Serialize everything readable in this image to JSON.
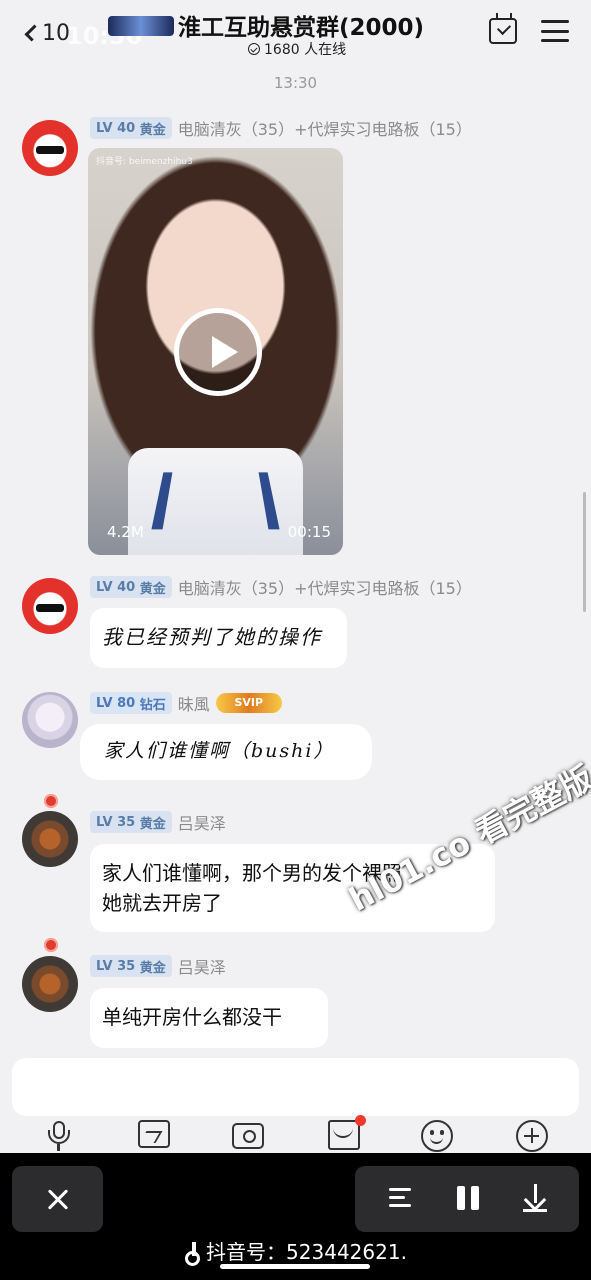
{
  "header": {
    "back_count": "10",
    "status_time": "10:50",
    "title": "淮工互助悬赏群(2000)",
    "online": "1680 人在线"
  },
  "timestamp": "13:30",
  "messages": [
    {
      "level": "LV 40",
      "rank": "黄金",
      "nick": "电脑清灰（35）+代焊实习电路板（15）",
      "type": "video",
      "video": {
        "size": "4.2M",
        "duration": "00:15",
        "watermark": "抖音号: beimenzhihu3"
      }
    },
    {
      "level": "LV 40",
      "rank": "黄金",
      "nick": "电脑清灰（35）+代焊实习电路板（15）",
      "type": "text",
      "text": "我已经预判了她的操作"
    },
    {
      "level": "LV 80",
      "rank": "钻石",
      "nick": "昧風",
      "badge": "SVIP",
      "type": "text",
      "text": "家人们谁懂啊（bushi）"
    },
    {
      "level": "LV 35",
      "rank": "黄金",
      "nick": "吕昊泽",
      "type": "text",
      "text_lines": [
        "家人们谁懂啊，那个男的发个裸照",
        "她就去开房了"
      ]
    },
    {
      "level": "LV 35",
      "rank": "黄金",
      "nick": "吕昊泽",
      "type": "text",
      "text": "单纯开房什么都没干"
    }
  ],
  "overlay_watermark": "hl01.co 看完整版",
  "toolbar": {
    "icons": [
      "microphone-icon",
      "image-icon",
      "camera-icon",
      "red-packet-icon",
      "emoji-icon",
      "plus-icon"
    ],
    "notification_color": "#f0392f"
  },
  "player": {
    "douyin_id": "抖音号：523442621."
  },
  "colors": {
    "background": "#f1f1f3",
    "bubble": "#ffffff",
    "level_badge": "#d8e2f0",
    "accent_red": "#e3312c"
  }
}
